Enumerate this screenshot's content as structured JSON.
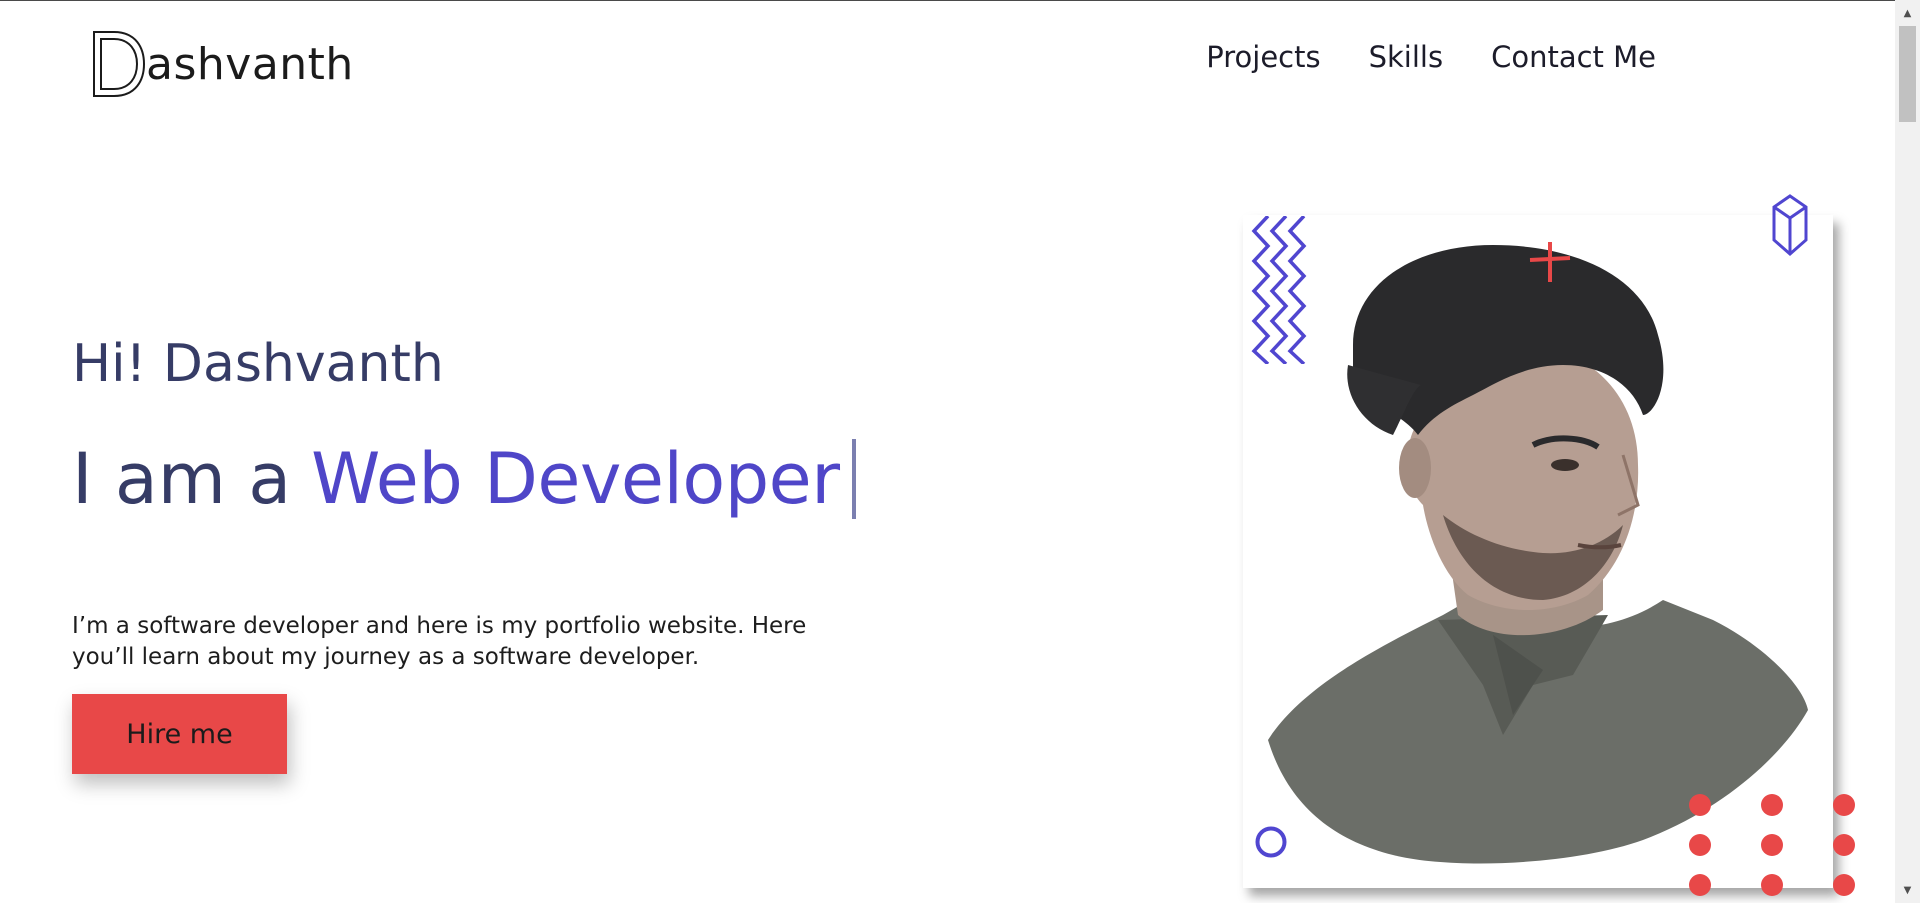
{
  "header": {
    "logo_text": "ashvanth",
    "logo_letter": "D",
    "nav": [
      {
        "label": "Projects"
      },
      {
        "label": "Skills"
      },
      {
        "label": "Contact Me"
      }
    ]
  },
  "hero": {
    "greeting": "Hi! Dashvanth",
    "headline_prefix": "I am a",
    "headline_role": "Web Developer",
    "bio": "I’m a software developer and here is my portfolio website. Here you’ll learn about my journey as a software developer.",
    "cta_label": "Hire me"
  },
  "colors": {
    "accent_purple": "#4f46c8",
    "accent_red": "#e84848",
    "text_navy": "#363c66"
  },
  "icons": {
    "zigzag": "zigzag-decoration-icon",
    "cube": "cube-outline-icon",
    "plus": "plus-decoration-icon",
    "circle": "circle-outline-icon",
    "dots": "dot-grid-icon"
  }
}
